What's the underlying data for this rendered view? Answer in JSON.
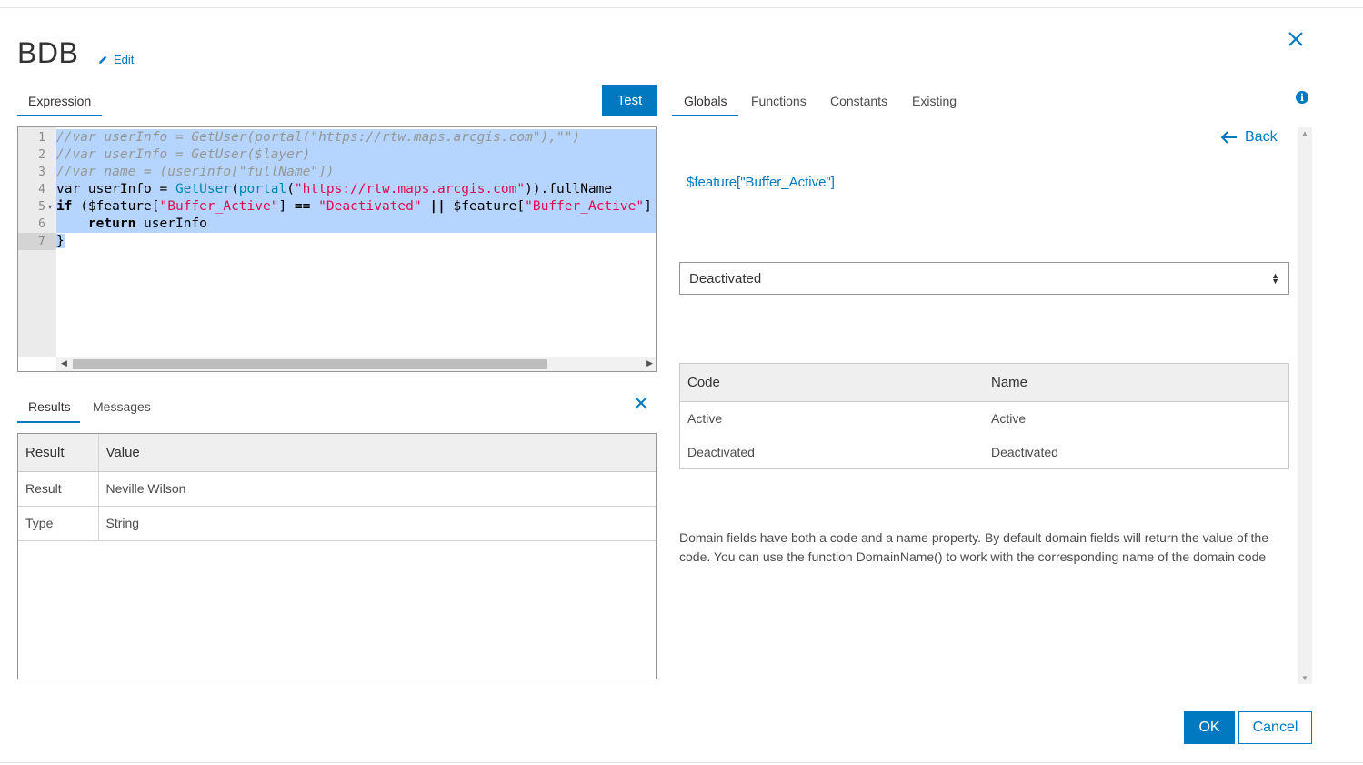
{
  "dialog": {
    "title": "BDB",
    "edit_label": "Edit"
  },
  "editor": {
    "tab_label": "Expression",
    "test_label": "Test",
    "lines": [
      {
        "n": "1",
        "parts": [
          {
            "t": "//var userInfo = GetUser(portal(\"https://rtw.maps.arcgis.com\"),\"\")",
            "c": "comment"
          }
        ]
      },
      {
        "n": "2",
        "parts": [
          {
            "t": "//var userInfo = GetUser($layer)",
            "c": "comment"
          }
        ]
      },
      {
        "n": "3",
        "parts": [
          {
            "t": "//var name = (userinfo[\"fullName\"])",
            "c": "comment"
          }
        ]
      },
      {
        "n": "4",
        "parts": [
          {
            "t": "var userInfo = ",
            "c": "plain"
          },
          {
            "t": "GetUser",
            "c": "fn"
          },
          {
            "t": "(",
            "c": "plain"
          },
          {
            "t": "portal",
            "c": "fn"
          },
          {
            "t": "(",
            "c": "plain"
          },
          {
            "t": "\"https://rtw.maps.arcgis.com\"",
            "c": "str"
          },
          {
            "t": ")).fullName",
            "c": "plain"
          }
        ]
      },
      {
        "n": "5",
        "parts": [
          {
            "t": "if",
            "c": "kwb"
          },
          {
            "t": " ($feature[",
            "c": "plain"
          },
          {
            "t": "\"Buffer_Active\"",
            "c": "str"
          },
          {
            "t": "] ",
            "c": "plain"
          },
          {
            "t": "==",
            "c": "kwb"
          },
          {
            "t": " ",
            "c": "plain"
          },
          {
            "t": "\"Deactivated\"",
            "c": "str"
          },
          {
            "t": " ",
            "c": "plain"
          },
          {
            "t": "||",
            "c": "kwb"
          },
          {
            "t": " $feature[",
            "c": "plain"
          },
          {
            "t": "\"Buffer_Active\"",
            "c": "str"
          },
          {
            "t": "]",
            "c": "plain"
          }
        ]
      },
      {
        "n": "6",
        "parts": [
          {
            "t": "    ",
            "c": "plain"
          },
          {
            "t": "return",
            "c": "kwb"
          },
          {
            "t": " userInfo",
            "c": "plain"
          }
        ]
      },
      {
        "n": "7",
        "parts": [
          {
            "t": "}",
            "c": "plain"
          }
        ]
      }
    ]
  },
  "results": {
    "tabs": [
      "Results",
      "Messages"
    ],
    "headers": [
      "Result",
      "Value"
    ],
    "rows": [
      [
        "Result",
        "Neville Wilson"
      ],
      [
        "Type",
        "String"
      ]
    ]
  },
  "right_panel": {
    "tabs": [
      "Globals",
      "Functions",
      "Constants",
      "Existing"
    ],
    "back_label": "Back",
    "feature_expression": "$feature[\"Buffer_Active\"]",
    "selected_value": "Deactivated",
    "domain_headers": [
      "Code",
      "Name"
    ],
    "domain_rows": [
      [
        "Active",
        "Active"
      ],
      [
        "Deactivated",
        "Deactivated"
      ]
    ],
    "note": "Domain fields have both a code and a name property. By default domain fields will return the value of the code. You can use the function DomainName() to work with the corresponding name of the domain code"
  },
  "footer": {
    "ok_label": "OK",
    "cancel_label": "Cancel"
  },
  "colors": {
    "accent": "#0079c1",
    "selection": "#b5d5ff",
    "string": "#df0b4f",
    "function": "#0086b3",
    "comment": "#969896"
  }
}
